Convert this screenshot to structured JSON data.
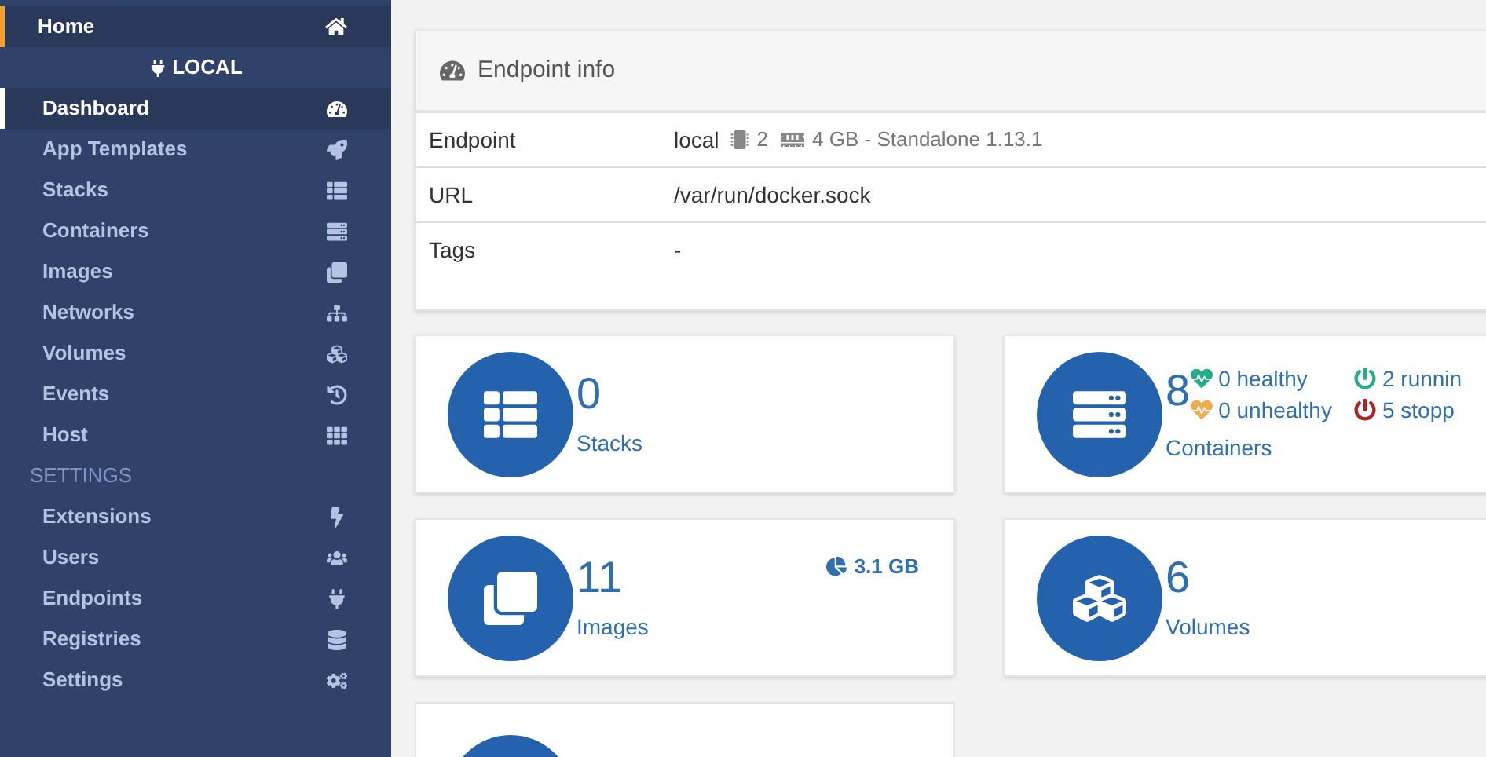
{
  "sidebar": {
    "home": {
      "label": "Home"
    },
    "endpoint_header": {
      "label": "LOCAL"
    },
    "items": [
      {
        "label": "Dashboard",
        "selected": true
      },
      {
        "label": "App Templates",
        "selected": false
      },
      {
        "label": "Stacks",
        "selected": false
      },
      {
        "label": "Containers",
        "selected": false
      },
      {
        "label": "Images",
        "selected": false
      },
      {
        "label": "Networks",
        "selected": false
      },
      {
        "label": "Volumes",
        "selected": false
      },
      {
        "label": "Events",
        "selected": false
      },
      {
        "label": "Host",
        "selected": false
      }
    ],
    "section_title": "SETTINGS",
    "settings_items": [
      {
        "label": "Extensions",
        "selected": false
      },
      {
        "label": "Users",
        "selected": false
      },
      {
        "label": "Endpoints",
        "selected": false
      },
      {
        "label": "Registries",
        "selected": false
      },
      {
        "label": "Settings",
        "selected": false
      }
    ]
  },
  "endpoint_info": {
    "title": "Endpoint info",
    "rows": [
      {
        "kind": "endpoint",
        "label": "Endpoint",
        "name": "local",
        "cpus": "2",
        "memory": "4 GB - Standalone 1.13.1"
      },
      {
        "kind": "text",
        "label": "URL",
        "value": "/var/run/docker.sock"
      },
      {
        "kind": "text",
        "label": "Tags",
        "value": "-"
      }
    ]
  },
  "cards": [
    {
      "kind": "stacks",
      "count": "0",
      "label": "Stacks"
    },
    {
      "kind": "containers",
      "count": "8",
      "label": "Containers",
      "stats": [
        {
          "kind": "health",
          "text": "0 healthy",
          "color": "#23ae89"
        },
        {
          "kind": "power",
          "text": "2 runnin",
          "color": "#23ae89"
        },
        {
          "kind": "health",
          "text": "0 unhealthy",
          "color": "#f0ad4e"
        },
        {
          "kind": "power",
          "text": "5 stopp",
          "color": "#ae2323"
        }
      ]
    },
    {
      "kind": "images",
      "count": "11",
      "label": "Images",
      "size": "3.1 GB"
    },
    {
      "kind": "volumes",
      "count": "6",
      "label": "Volumes"
    }
  ]
}
